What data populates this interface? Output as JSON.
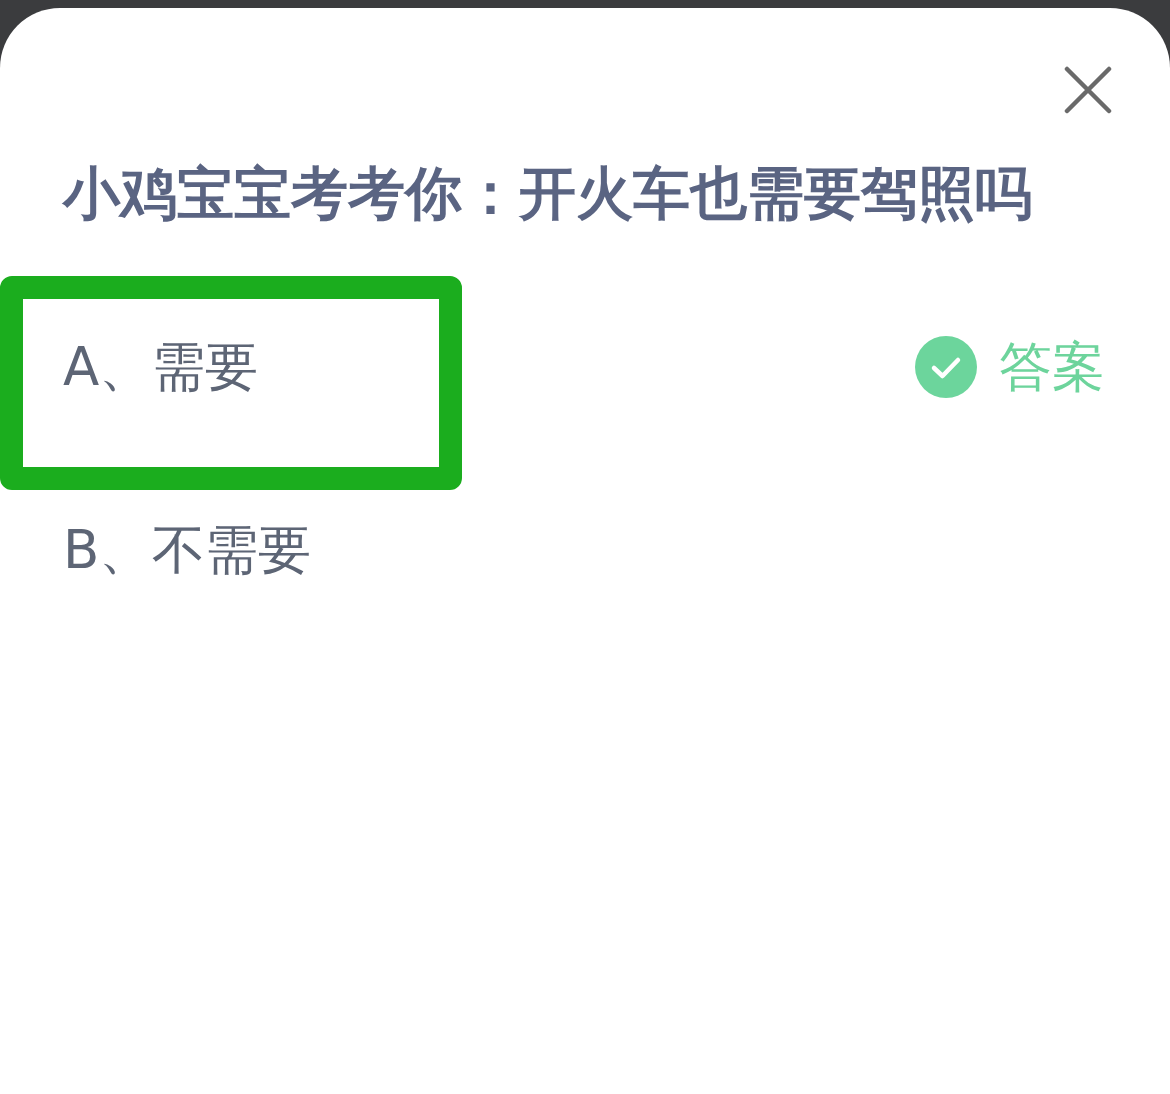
{
  "question": "小鸡宝宝考考你：开火车也需要驾照吗",
  "options": [
    {
      "label": "A、需要",
      "highlighted": true,
      "answer": true
    },
    {
      "label": "B、不需要",
      "highlighted": false,
      "answer": false
    }
  ],
  "answer_label": "答案"
}
